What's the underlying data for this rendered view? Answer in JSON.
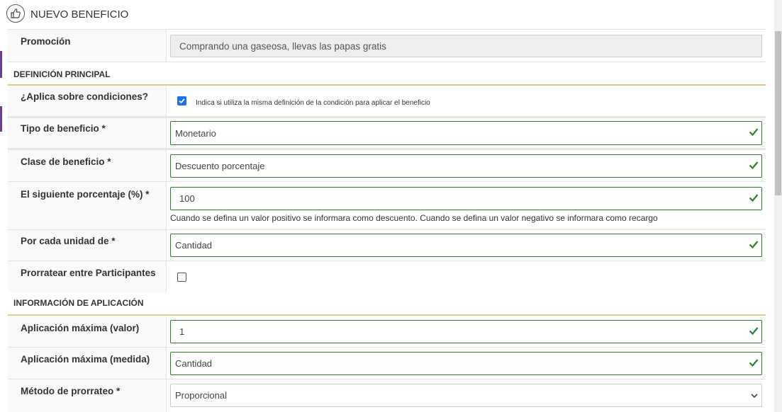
{
  "header": {
    "title": "NUEVO BENEFICIO",
    "icon": "thumbs-up-icon"
  },
  "promocion": {
    "label": "Promoción",
    "value": "Comprando una gaseosa, llevas las papas gratis"
  },
  "sections": {
    "principal": "DEFINICIÓN PRINCIPAL",
    "aplicacion": "INFORMACIÓN DE APLICACIÓN"
  },
  "aplica_condiciones": {
    "label": "¿Aplica sobre condiciones?",
    "checked": true,
    "help": "Indica si utiliza la misma definición de la condición para aplicar el beneficio"
  },
  "tipo_beneficio": {
    "label": "Tipo de beneficio *",
    "value": "Monetario"
  },
  "clase_beneficio": {
    "label": "Clase de beneficio *",
    "value": "Descuento porcentaje"
  },
  "porcentaje": {
    "label": "El siguiente porcentaje (%) *",
    "value": "100",
    "help": "Cuando se defina un valor positivo se informara como descuento. Cuando se defina un valor negativo se informara como recargo"
  },
  "unidad": {
    "label": "Por cada unidad de *",
    "value": "Cantidad"
  },
  "prorratear": {
    "label": "Prorratear entre Participantes",
    "checked": false
  },
  "aplicacion_max_valor": {
    "label": "Aplicación máxima (valor)",
    "value": "1"
  },
  "aplicacion_max_medida": {
    "label": "Aplicación máxima (medida)",
    "value": "Cantidad"
  },
  "metodo_prorrateo": {
    "label": "Método de prorrateo *",
    "value": "Proporcional"
  },
  "colors": {
    "accent": "#6a3d8e",
    "valid": "#2e7d32",
    "section_line": "#e8c98c",
    "checkbox": "#1a73e8"
  }
}
